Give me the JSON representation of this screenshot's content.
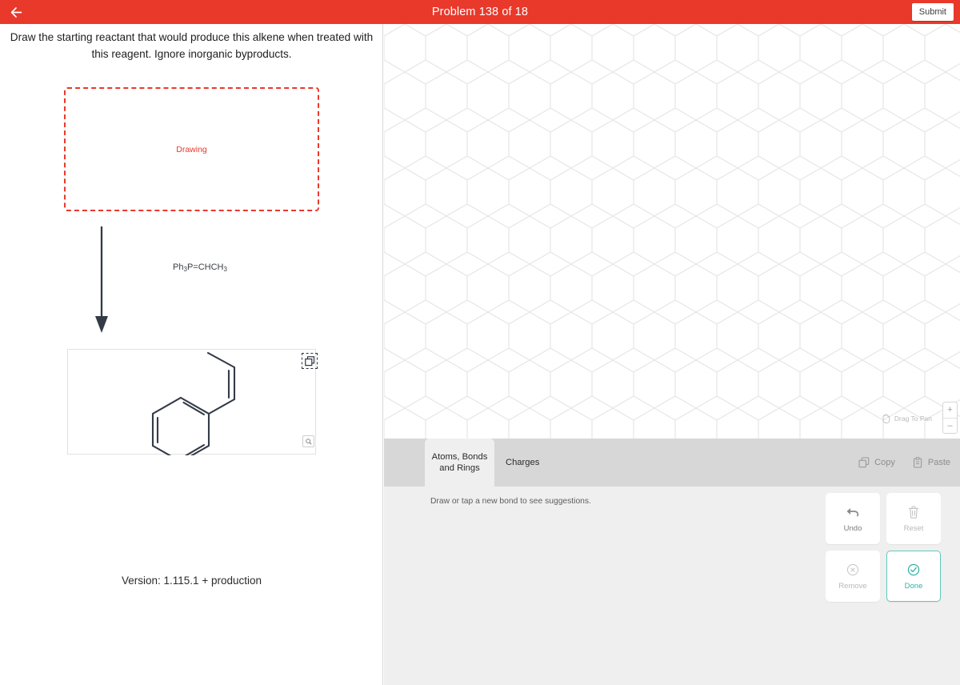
{
  "header": {
    "back_icon": "arrow-left-icon",
    "title": "Problem 138 of 18",
    "submit_label": "Submit",
    "bg_color": "#e8392b"
  },
  "problem": {
    "prompt": "Draw the starting reactant that would produce this alkene when treated with this reagent.  Ignore inorganic byproducts.",
    "drawing_placeholder": "Drawing",
    "drawing_border_color": "#e8392b",
    "reagent_formula": "Ph₃P=CHCH₃",
    "reagent_parts": {
      "a": "Ph",
      "a_sub": "3",
      "b": "P=CHCH",
      "b_sub": "3"
    },
    "arrow_icon": "down-arrow-icon",
    "product_structure_name": "cis-beta-methylstyrene",
    "duplicate_icon": "duplicate-icon",
    "zoom_icon": "magnifier-icon",
    "version": "Version: 1.115.1 +  production"
  },
  "canvas": {
    "grid": "hexagonal-grid",
    "grid_color": "#e3e3e3",
    "pan_hint": "Drag To Pan",
    "pan_icon": "hand-icon",
    "zoom_in_label": "+",
    "zoom_out_label": "–"
  },
  "toolbar": {
    "tabs": [
      {
        "label": "Atoms, Bonds and Rings",
        "active": true
      },
      {
        "label": "Charges",
        "active": false
      }
    ],
    "copy_label": "Copy",
    "copy_icon": "copy-icon",
    "paste_label": "Paste",
    "paste_icon": "clipboard-icon"
  },
  "editor": {
    "hint": "Draw or tap a new bond to see suggestions.",
    "actions": [
      {
        "label": "Undo",
        "icon": "undo-arrow-icon",
        "state": "enabled"
      },
      {
        "label": "Reset",
        "icon": "trash-icon",
        "state": "disabled"
      },
      {
        "label": "Remove",
        "icon": "x-circle-icon",
        "state": "disabled"
      },
      {
        "label": "Done",
        "icon": "check-circle-icon",
        "state": "primary",
        "accent": "#2fb3a6"
      }
    ]
  }
}
